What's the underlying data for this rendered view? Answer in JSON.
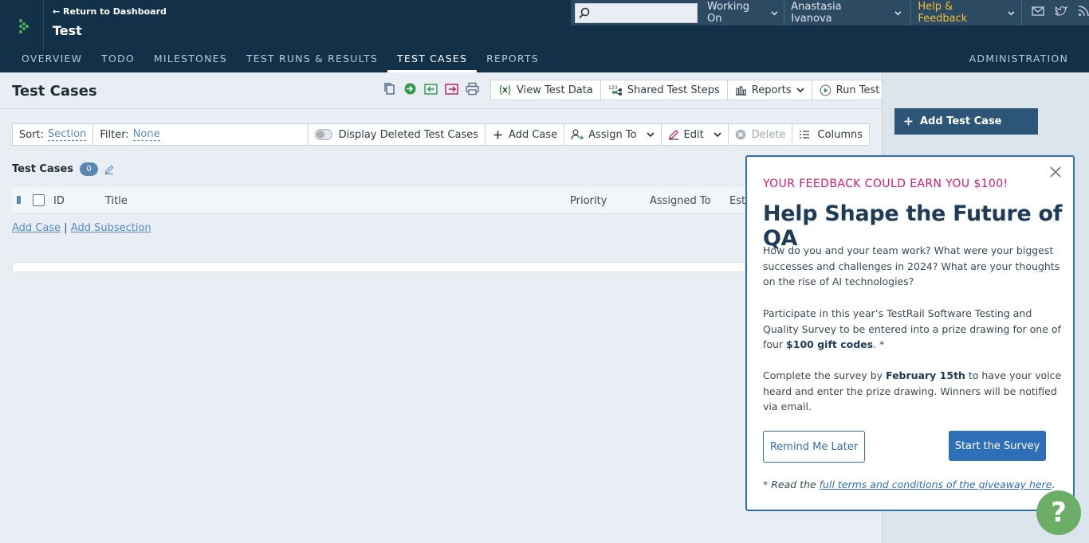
{
  "header": {
    "back_link": "← Return to Dashboard",
    "project_title": "Test",
    "search_placeholder": "",
    "working_on": "Working On",
    "user_name": "Anastasia Ivanova",
    "help_feedback": "Help & Feedback",
    "icons": [
      "mail-icon",
      "twitter-icon",
      "rss-icon"
    ]
  },
  "nav": {
    "tabs": [
      {
        "label": "OVERVIEW"
      },
      {
        "label": "TODO"
      },
      {
        "label": "MILESTONES"
      },
      {
        "label": "TEST RUNS & RESULTS"
      },
      {
        "label": "TEST CASES",
        "active": true
      },
      {
        "label": "REPORTS"
      }
    ],
    "admin": "ADMINISTRATION"
  },
  "page": {
    "title": "Test Cases",
    "header_buttons": {
      "view_test_data": "View Test Data",
      "shared_test_steps": "Shared Test Steps",
      "reports": "Reports",
      "run_test": "Run Test"
    }
  },
  "toolbar": {
    "sort_label": "Sort:",
    "sort_value": "Section",
    "filter_label": "Filter:",
    "filter_value": "None",
    "display_deleted": "Display Deleted Test Cases",
    "add_case": "Add Case",
    "assign_to": "Assign To",
    "edit": "Edit",
    "delete": "Delete",
    "columns": "Columns"
  },
  "section": {
    "title": "Test Cases",
    "count": "0"
  },
  "table": {
    "columns": [
      "ID",
      "Title",
      "Priority",
      "Assigned To",
      "Est"
    ]
  },
  "add_links": {
    "add_case": "Add Case",
    "separator": "|",
    "add_subsection": "Add Subsection"
  },
  "sidebar": {
    "add_test_case": "Add Test Case"
  },
  "modal": {
    "kicker": "YOUR FEEDBACK COULD EARN YOU $100!",
    "title": "Help Shape the Future of QA",
    "para1": "How do you and your team work? What were your biggest successes and challenges in 2024? What are your thoughts on the rise of AI technologies?",
    "para2_pre": "Participate in this year’s TestRail Software Testing and Quality Survey to be entered into a prize drawing for one of four ",
    "para2_bold": "$100 gift codes",
    "para2_post": ". *",
    "para3_pre": "Complete the survey by ",
    "para3_bold": "February 15th",
    "para3_post": " to have your voice heard and enter the prize drawing. Winners will be notified via email.",
    "remind_later": "Remind Me Later",
    "start_survey": "Start the Survey",
    "footnote_pre": "* Read the ",
    "footnote_link": "full terms and conditions of the giveaway here",
    "footnote_post": "."
  },
  "help_fab": "?",
  "colors": {
    "topbar": "#123047",
    "accent_blue": "#2f6fb8",
    "kicker_pink": "#d7196b",
    "help_yellow": "#f2c037",
    "fab_green": "#6cae68"
  }
}
